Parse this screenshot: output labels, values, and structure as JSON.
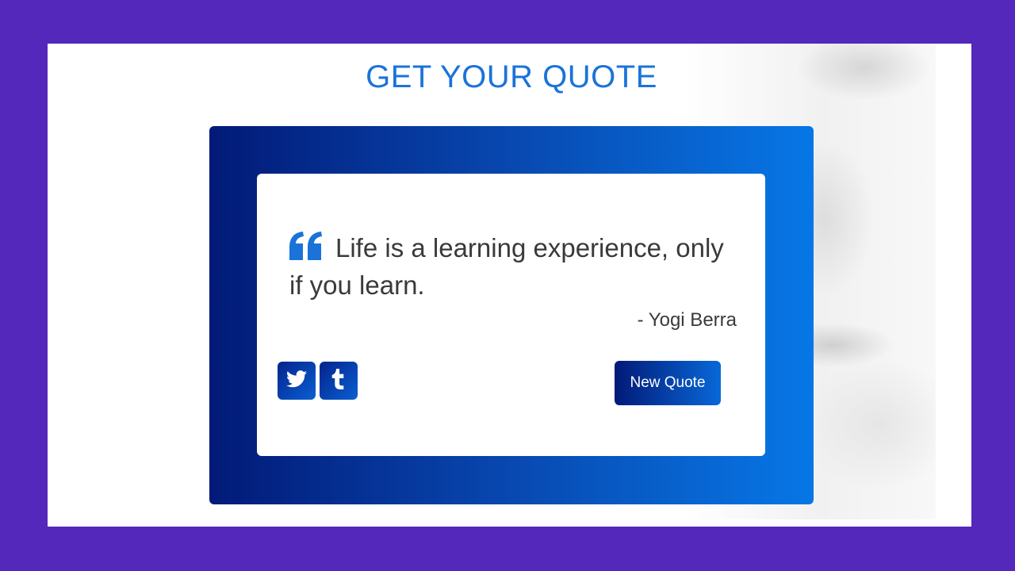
{
  "page": {
    "title": "GET YOUR QUOTE"
  },
  "quote": {
    "text": "Life is a learning experience, only if you learn.",
    "author": "- Yogi Berra",
    "icon": "quote-left-icon"
  },
  "share": {
    "twitter_icon": "twitter-icon",
    "tumblr_icon": "tumblr-icon"
  },
  "actions": {
    "new_quote_label": "New Quote"
  },
  "colors": {
    "page_border": "#5328bb",
    "title": "#1a73d9",
    "frame_start": "#021a78",
    "frame_end": "#0777e6",
    "quote_icon": "#1a73d9",
    "text": "#3a3a3a"
  }
}
